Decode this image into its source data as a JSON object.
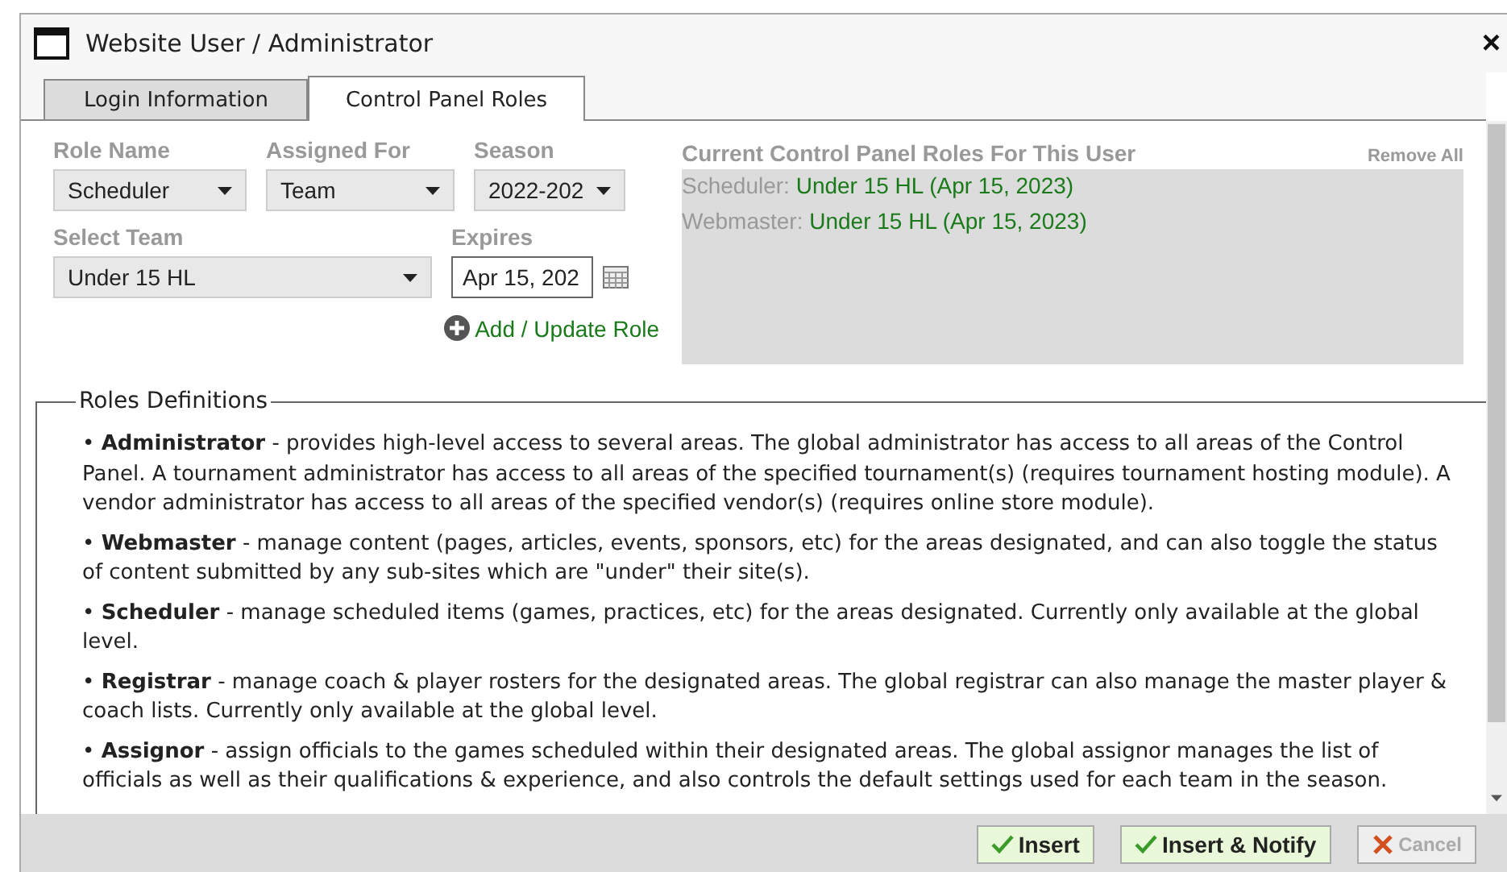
{
  "window": {
    "title": "Website User / Administrator",
    "close": "×"
  },
  "tabs": [
    {
      "label": "Login Information",
      "selected": false
    },
    {
      "label": "Control Panel Roles",
      "selected": true
    }
  ],
  "form": {
    "role_name": {
      "label": "Role Name",
      "value": "Scheduler"
    },
    "assigned_for": {
      "label": "Assigned For",
      "value": "Team"
    },
    "season": {
      "label": "Season",
      "value": "2022-202"
    },
    "select_team": {
      "label": "Select Team",
      "value": "Under 15 HL"
    },
    "expires": {
      "label": "Expires",
      "value": "Apr 15, 202"
    },
    "add_button": "Add / Update Role"
  },
  "current_roles": {
    "title": "Current Control Panel Roles For This User",
    "remove_all": "Remove All",
    "items": [
      {
        "role": "Scheduler:",
        "value": "Under 15 HL (Apr 15, 2023)"
      },
      {
        "role": "Webmaster:",
        "value": "Under 15 HL (Apr 15, 2023)"
      }
    ]
  },
  "definitions": {
    "title": "Roles Definitions",
    "items": [
      "• **Administrator** - provides high-level access to several areas. The global administrator has access to all areas of the Control Panel. A tournament administrator has access to all areas of the specified tournament(s) (requires tournament hosting module). A vendor administrator has access to all areas of the specified vendor(s) (requires online store module).",
      "• **Webmaster** - manage content (pages, articles, events, sponsors, etc) for the areas designated, and can also toggle the status of content submitted by any sub-sites which are \"under\" their site(s).",
      "• **Scheduler** - manage scheduled items (games, practices, etc) for the areas designated. Currently only available at the global level.",
      "• **Registrar** - manage coach & player rosters for the designated areas. The global registrar can also manage the master player & coach lists. Currently only available at the global level.",
      "• **Assignor** - assign officials to the games scheduled within their designated areas. The global assignor manages the list of officials as well as their qualifications & experience, and also controls the default settings used for each team in the season."
    ]
  },
  "buttons": [
    {
      "label": "Insert",
      "kind": "ok",
      "disabled": false
    },
    {
      "label": "Insert & Notify",
      "kind": "ok",
      "disabled": false
    },
    {
      "label": "Cancel",
      "kind": "cancel",
      "disabled": true
    }
  ]
}
